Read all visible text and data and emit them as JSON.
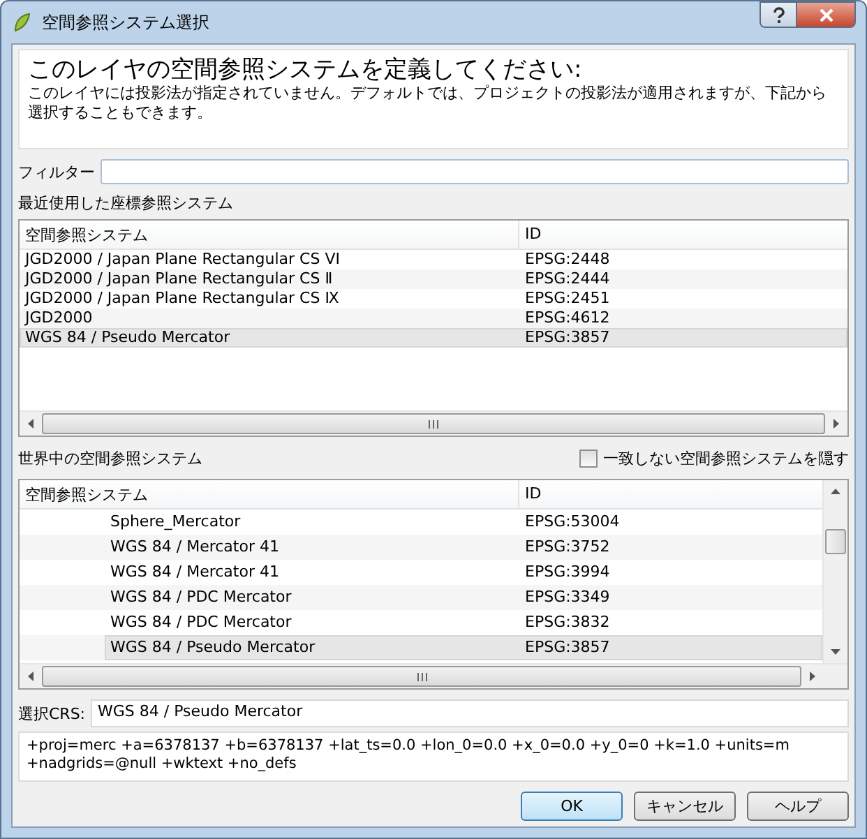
{
  "window": {
    "title": "空間参照システム選択"
  },
  "header": {
    "heading": "このレイヤの空間参照システムを定義してください:",
    "message": "このレイヤには投影法が指定されていません。デフォルトでは、プロジェクトの投影法が適用されますが、下記から選択することもできます。"
  },
  "filter": {
    "label": "フィルター"
  },
  "recent": {
    "label": "最近使用した座標参照システム",
    "columns": [
      "空間参照システム",
      "ID"
    ],
    "rows": [
      {
        "name": "JGD2000 / Japan Plane Rectangular CS VI",
        "id": "EPSG:2448",
        "selected": false
      },
      {
        "name": "JGD2000 / Japan Plane Rectangular CS Ⅱ",
        "id": "EPSG:2444",
        "selected": false
      },
      {
        "name": "JGD2000 / Japan Plane Rectangular CS Ⅸ",
        "id": "EPSG:2451",
        "selected": false
      },
      {
        "name": "JGD2000",
        "id": "EPSG:4612",
        "selected": false
      },
      {
        "name": "WGS 84 / Pseudo Mercator",
        "id": "EPSG:3857",
        "selected": true
      }
    ]
  },
  "world": {
    "label": "世界中の空間参照システム",
    "hide_unmatched": {
      "label": "一致しない空間参照システムを隠す",
      "checked": false
    },
    "columns": [
      "空間参照システム",
      "ID"
    ],
    "rows": [
      {
        "name": "Sphere_Mercator",
        "id": "EPSG:53004",
        "selected": false
      },
      {
        "name": "WGS 84 / Mercator 41",
        "id": "EPSG:3752",
        "selected": false
      },
      {
        "name": "WGS 84 / Mercator 41",
        "id": "EPSG:3994",
        "selected": false
      },
      {
        "name": "WGS 84 / PDC Mercator",
        "id": "EPSG:3349",
        "selected": false
      },
      {
        "name": "WGS 84 / PDC Mercator",
        "id": "EPSG:3832",
        "selected": false
      },
      {
        "name": "WGS 84 / Pseudo Mercator",
        "id": "EPSG:3857",
        "selected": true
      }
    ]
  },
  "selected_crs": {
    "label": "選択CRS:",
    "value": "WGS 84 / Pseudo Mercator"
  },
  "proj_string": "+proj=merc +a=6378137 +b=6378137 +lat_ts=0.0 +lon_0=0.0 +x_0=0.0 +y_0=0 +k=1.0 +units=m +nadgrids=@null +wktext +no_defs",
  "buttons": [
    {
      "label": "OK",
      "default": true
    },
    {
      "label": "キャンセル",
      "default": false
    },
    {
      "label": "ヘルプ",
      "default": false
    }
  ]
}
